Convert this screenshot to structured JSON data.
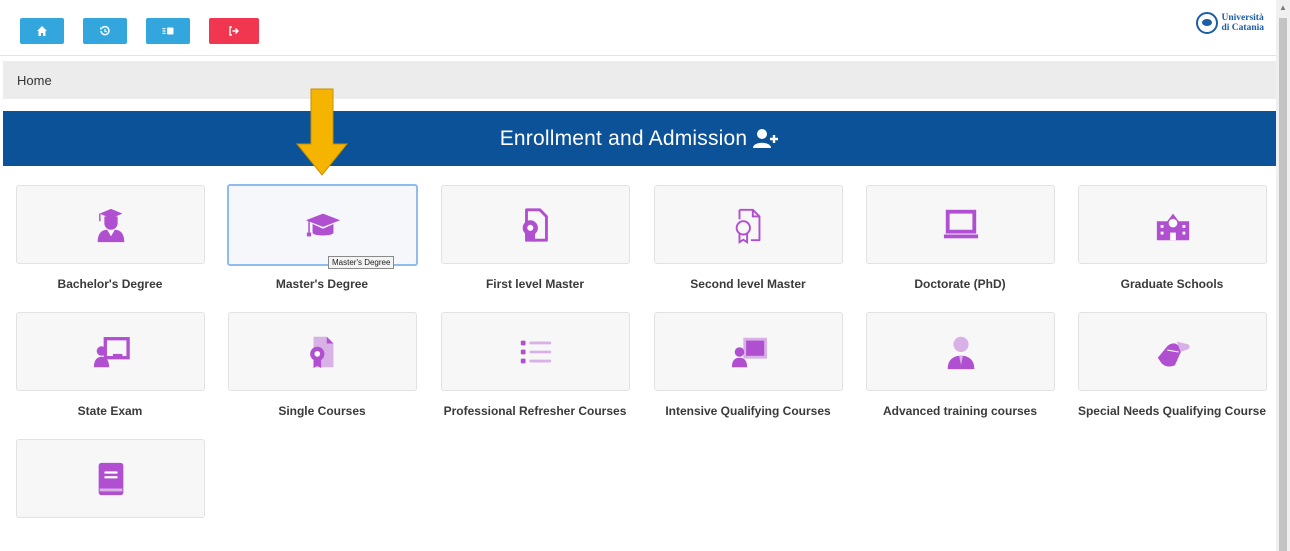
{
  "toolbar": {
    "buttons": [
      {
        "name": "home",
        "color": "#33a6dd"
      },
      {
        "name": "history",
        "color": "#33a6dd"
      },
      {
        "name": "id-card",
        "color": "#33a6dd"
      },
      {
        "name": "logout",
        "color": "#f1364f"
      }
    ]
  },
  "logo": {
    "line1": "Università",
    "line2": "di Catania"
  },
  "breadcrumb": {
    "current": "Home"
  },
  "banner": {
    "title": "Enrollment and Admission",
    "icon": "user-plus-icon",
    "color": "#0b5299"
  },
  "accent_color": "#b04fd0",
  "cards": [
    {
      "label": "Bachelor's Degree",
      "icon": "graduate-student-icon"
    },
    {
      "label": "Master's Degree",
      "icon": "graduation-cap-icon",
      "selected": true
    },
    {
      "label": "First level Master",
      "icon": "certificate-icon"
    },
    {
      "label": "Second level Master",
      "icon": "certificate-outline-icon"
    },
    {
      "label": "Doctorate (PhD)",
      "icon": "laptop-icon"
    },
    {
      "label": "Graduate Schools",
      "icon": "school-building-icon"
    },
    {
      "label": "State Exam",
      "icon": "teacher-board-icon"
    },
    {
      "label": "Single Courses",
      "icon": "certificate-document-icon"
    },
    {
      "label": "Professional Refresher Courses",
      "icon": "list-icon"
    },
    {
      "label": "Intensive Qualifying Courses",
      "icon": "presenter-icon"
    },
    {
      "label": "Advanced training courses",
      "icon": "business-person-icon"
    },
    {
      "label": "Special Needs Qualifying Course",
      "icon": "helping-hand-icon"
    },
    {
      "label": "",
      "icon": "book-icon"
    }
  ],
  "tooltip": {
    "text": "Master's Degree"
  },
  "annotation": {
    "type": "arrow",
    "color": "#f5b400"
  }
}
